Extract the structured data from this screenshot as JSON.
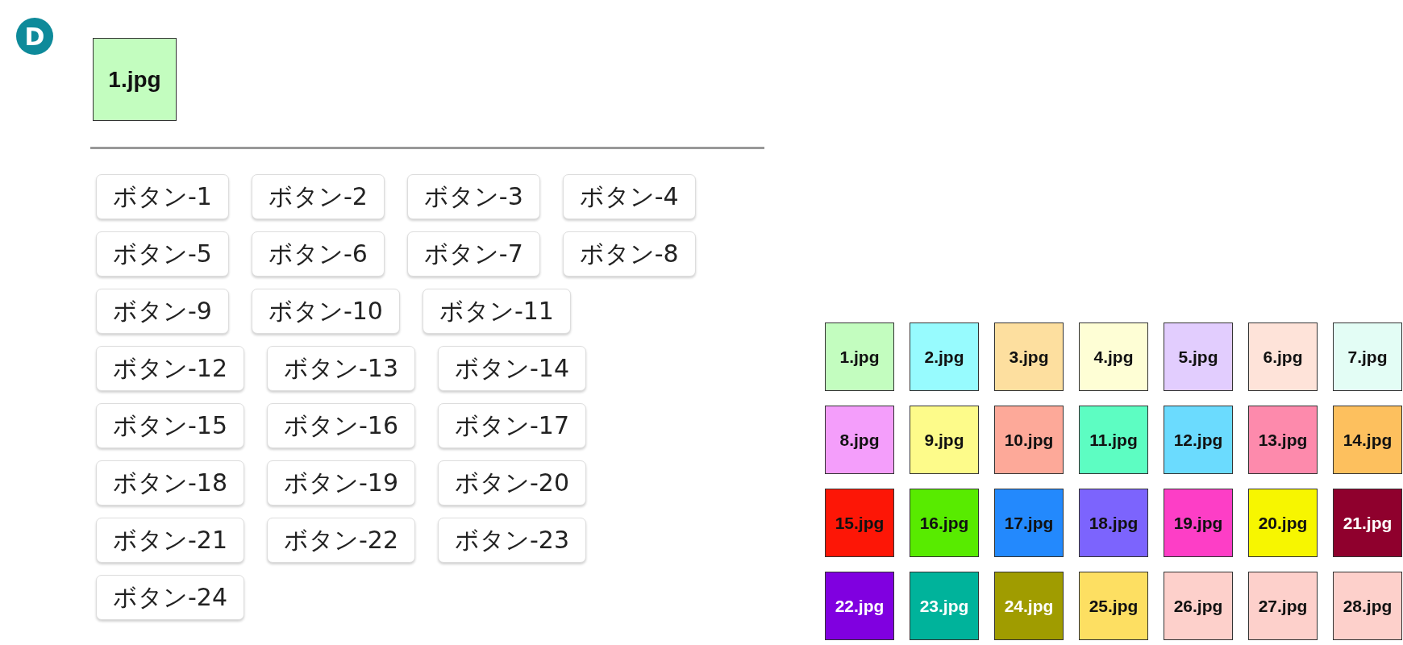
{
  "badge": {
    "label": "D"
  },
  "preview": {
    "label": "1.jpg",
    "color": "#c3fdbf",
    "inverse": false
  },
  "button_rows": [
    [
      "ボタン-1",
      "ボタン-2",
      "ボタン-3",
      "ボタン-4"
    ],
    [
      "ボタン-5",
      "ボタン-6",
      "ボタン-7",
      "ボタン-8"
    ],
    [
      "ボタン-9",
      "ボタン-10",
      "ボタン-11"
    ],
    [
      "ボタン-12",
      "ボタン-13",
      "ボタン-14"
    ],
    [
      "ボタン-15",
      "ボタン-16",
      "ボタン-17"
    ],
    [
      "ボタン-18",
      "ボタン-19",
      "ボタン-20"
    ],
    [
      "ボタン-21",
      "ボタン-22",
      "ボタン-23"
    ],
    [
      "ボタン-24"
    ]
  ],
  "tiles": [
    {
      "label": "1.jpg",
      "color": "#c3fdbf",
      "inverse": false
    },
    {
      "label": "2.jpg",
      "color": "#97fbfe",
      "inverse": false
    },
    {
      "label": "3.jpg",
      "color": "#fddf9f",
      "inverse": false
    },
    {
      "label": "4.jpg",
      "color": "#fefed5",
      "inverse": false
    },
    {
      "label": "5.jpg",
      "color": "#e2cdfe",
      "inverse": false
    },
    {
      "label": "6.jpg",
      "color": "#fee3d9",
      "inverse": false
    },
    {
      "label": "7.jpg",
      "color": "#e3fdf5",
      "inverse": false
    },
    {
      "label": "8.jpg",
      "color": "#f49efb",
      "inverse": false
    },
    {
      "label": "9.jpg",
      "color": "#fdfb8a",
      "inverse": false
    },
    {
      "label": "10.jpg",
      "color": "#fda999",
      "inverse": false
    },
    {
      "label": "11.jpg",
      "color": "#5dfdc2",
      "inverse": false
    },
    {
      "label": "12.jpg",
      "color": "#6bdbfe",
      "inverse": false
    },
    {
      "label": "13.jpg",
      "color": "#fd8aac",
      "inverse": false
    },
    {
      "label": "14.jpg",
      "color": "#fdc05e",
      "inverse": false
    },
    {
      "label": "15.jpg",
      "color": "#fd1606",
      "inverse": false
    },
    {
      "label": "16.jpg",
      "color": "#58eb00",
      "inverse": false
    },
    {
      "label": "17.jpg",
      "color": "#2389fd",
      "inverse": false
    },
    {
      "label": "18.jpg",
      "color": "#7c64fd",
      "inverse": false
    },
    {
      "label": "19.jpg",
      "color": "#fd3ec6",
      "inverse": false
    },
    {
      "label": "20.jpg",
      "color": "#f7f600",
      "inverse": false
    },
    {
      "label": "21.jpg",
      "color": "#8f002d",
      "inverse": true
    },
    {
      "label": "22.jpg",
      "color": "#8000e0",
      "inverse": true
    },
    {
      "label": "23.jpg",
      "color": "#00b39b",
      "inverse": true
    },
    {
      "label": "24.jpg",
      "color": "#a09c00",
      "inverse": true
    },
    {
      "label": "25.jpg",
      "color": "#fddf62",
      "inverse": false
    },
    {
      "label": "26.jpg",
      "color": "#fdd0cb",
      "inverse": false
    },
    {
      "label": "27.jpg",
      "color": "#fdd0cb",
      "inverse": false
    },
    {
      "label": "28.jpg",
      "color": "#fdd0cb",
      "inverse": false
    }
  ]
}
